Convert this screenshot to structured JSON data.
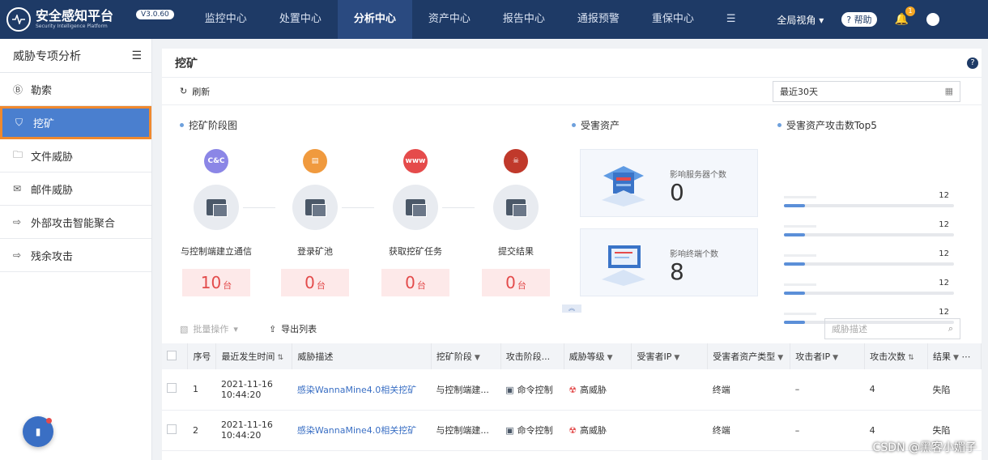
{
  "header": {
    "app_name": "安全感知平台",
    "app_subtitle": "Security Intelligence Platform",
    "version": "V3.0.60",
    "nav": [
      "监控中心",
      "处置中心",
      "分析中心",
      "资产中心",
      "报告中心",
      "通报预警",
      "重保中心"
    ],
    "menu_more": "☰",
    "view_label": "全局视角",
    "help_label": "帮助",
    "notifications_count": "1"
  },
  "sidebar": {
    "title": "威胁专项分析",
    "items": [
      {
        "label": "勒索",
        "icon": "Ⓑ"
      },
      {
        "label": "挖矿",
        "icon": "⛉"
      },
      {
        "label": "文件威胁",
        "icon": "🗀"
      },
      {
        "label": "邮件威胁",
        "icon": "✉"
      },
      {
        "label": "外部攻击智能聚合",
        "icon": "⇨"
      },
      {
        "label": "残余攻击",
        "icon": "⇨"
      }
    ]
  },
  "main": {
    "title": "挖矿",
    "refresh_label": "刷新",
    "date_range": "最近30天",
    "stage_section_title": "挖矿阶段图",
    "stages": [
      {
        "label": "与控制端建立通信",
        "count": "10",
        "unit": "台",
        "icon_text": "C&C",
        "color": "#8b86e6"
      },
      {
        "label": "登录矿池",
        "count": "0",
        "unit": "台",
        "icon_text": "▤",
        "color": "#f09a3e"
      },
      {
        "label": "获取挖矿任务",
        "count": "0",
        "unit": "台",
        "icon_text": "www",
        "color": "#e54b4b"
      },
      {
        "label": "提交结果",
        "count": "0",
        "unit": "台",
        "icon_text": "☠",
        "color": "#c0392b"
      }
    ],
    "assets_section_title": "受害资产",
    "assets": [
      {
        "label": "影响服务器个数",
        "value": "0"
      },
      {
        "label": "影响终端个数",
        "value": "8"
      }
    ],
    "top5_section_title": "受害资产攻击数Top5",
    "top5": [
      12,
      12,
      12,
      12,
      12
    ],
    "batch_label": "批量操作",
    "export_label": "导出列表",
    "search_placeholder": "威胁描述",
    "columns": [
      "序号",
      "最近发生时间",
      "威胁描述",
      "挖矿阶段",
      "攻击阶段...",
      "威胁等级",
      "受害者IP",
      "受害者资产类型",
      "攻击者IP",
      "攻击次数",
      "结果"
    ],
    "rows": [
      {
        "no": "1",
        "time": "2021-11-16",
        "time2": "10:44:20",
        "desc": "感染WannaMine4.0相关挖矿",
        "stage": "与控制端建...",
        "attack": "命令控制",
        "level": "高威胁",
        "victim_ip": "",
        "asset_type": "终端",
        "attacker_ip": "–",
        "count": "4",
        "result": "失陷"
      },
      {
        "no": "2",
        "time": "2021-11-16",
        "time2": "10:44:20",
        "desc": "感染WannaMine4.0相关挖矿",
        "stage": "与控制端建...",
        "attack": "命令控制",
        "level": "高威胁",
        "victim_ip": "",
        "asset_type": "终端",
        "attacker_ip": "–",
        "count": "4",
        "result": "失陷"
      }
    ]
  },
  "watermark": "CSDN @黑客小媚子"
}
